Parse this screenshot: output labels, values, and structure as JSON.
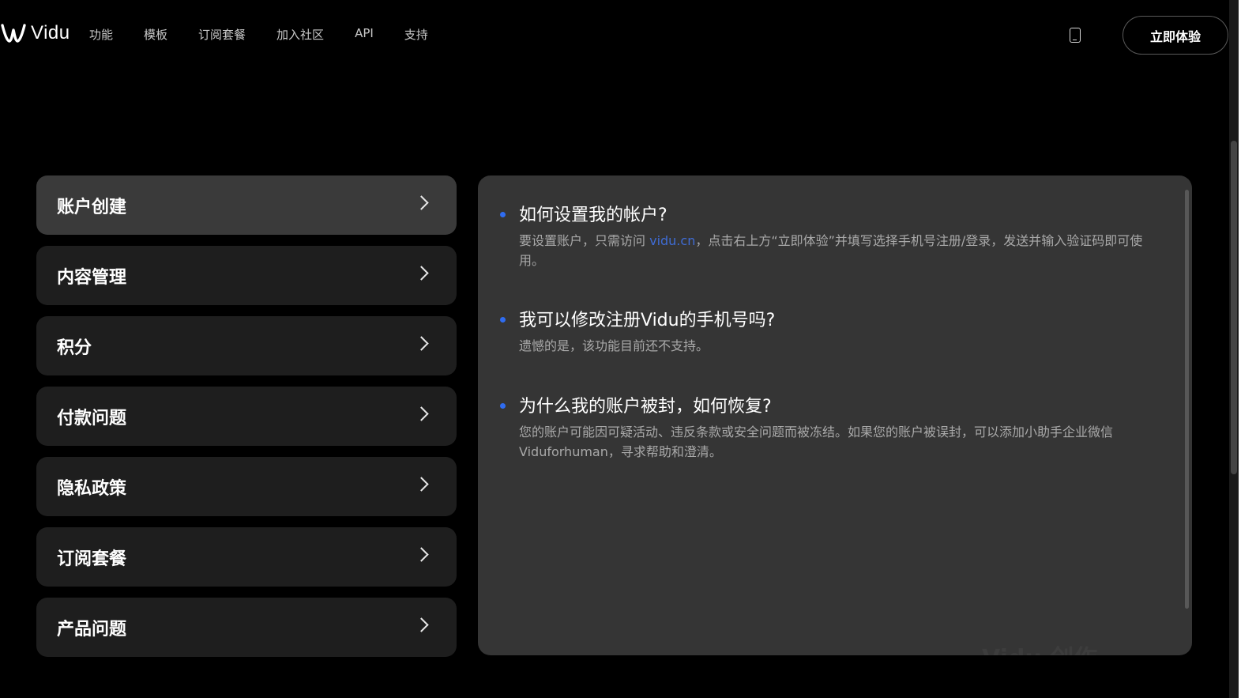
{
  "header": {
    "logo_text": "Vidu",
    "nav": [
      "功能",
      "模板",
      "订阅套餐",
      "加入社区",
      "API",
      "支持"
    ],
    "cta_label": "立即体验"
  },
  "categories": [
    {
      "label": "账户创建",
      "active": true
    },
    {
      "label": "内容管理",
      "active": false
    },
    {
      "label": "积分",
      "active": false
    },
    {
      "label": "付款问题",
      "active": false
    },
    {
      "label": "隐私政策",
      "active": false
    },
    {
      "label": "订阅套餐",
      "active": false
    },
    {
      "label": "产品问题",
      "active": false
    }
  ],
  "faq": {
    "items": [
      {
        "question": "如何设置我的帐户?",
        "answer_pre": "要设置账户，只需访问 ",
        "answer_link": "vidu.cn",
        "answer_post": "，点击右上方“立即体验”并填写选择手机号注册/登录，发送并输入验证码即可使用。"
      },
      {
        "question": "我可以修改注册Vidu的手机号吗?",
        "answer": "遗憾的是，该功能目前还不支持。"
      },
      {
        "question": "为什么我的账户被封，如何恢复?",
        "answer": "您的账户可能因可疑活动、违反条款或安全问题而被冻结。如果您的账户被误封，可以添加小助手企业微信Viduforhuman，寻求帮助和澄清。"
      }
    ],
    "watermark": "Vidu 创作"
  },
  "colors": {
    "bullet": "#2f6cf0",
    "link": "#3f6cd4",
    "panel_bg": "#353535",
    "card_bg": "#1e1e1e",
    "card_active_bg": "#3a3a3a"
  },
  "icons": {
    "logo": "vidu-logo-icon",
    "phone": "mobile-phone-icon",
    "chevron": "chevron-right-icon"
  }
}
